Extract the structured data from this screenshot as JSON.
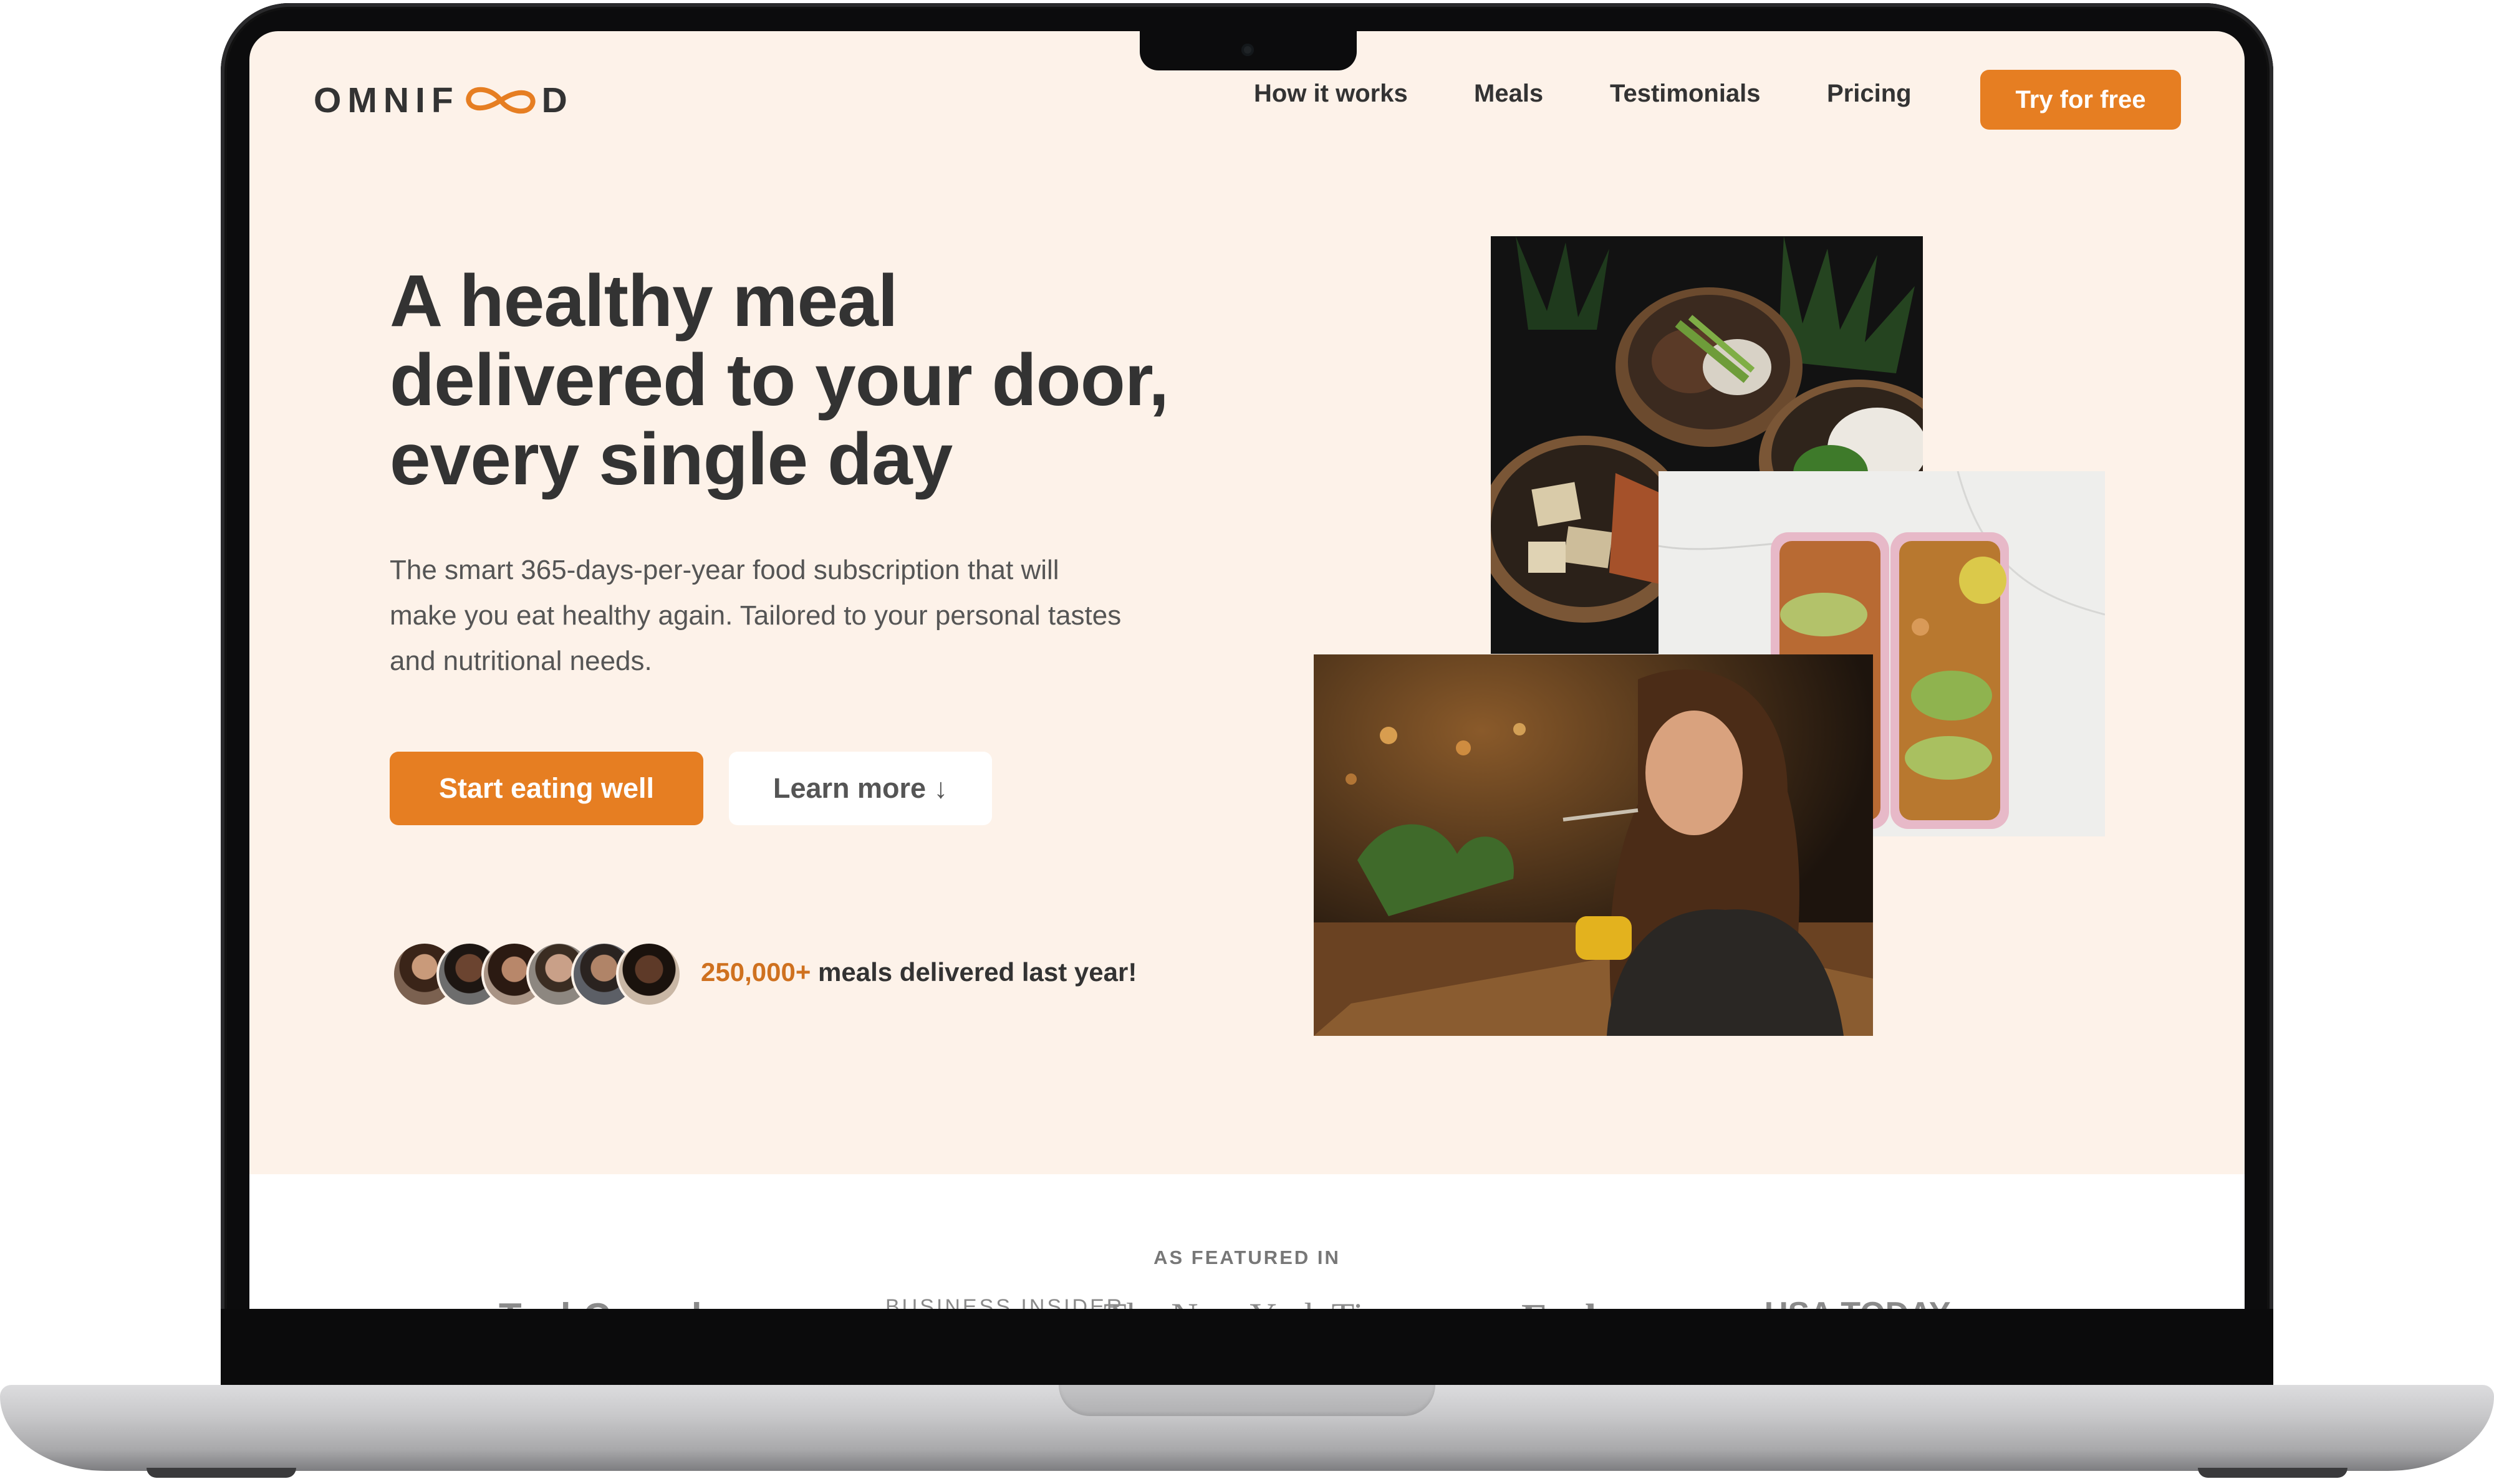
{
  "brand": {
    "logo_text_left": "OMNIF",
    "logo_text_right": "D",
    "accent": "#e67e22",
    "accent_dark": "#cf711f",
    "background": "#fdf2e9"
  },
  "nav": {
    "links": [
      "How it works",
      "Meals",
      "Testimonials",
      "Pricing"
    ],
    "cta": "Try for free"
  },
  "hero": {
    "title_line1": "A healthy meal",
    "title_line2": "delivered to your door,",
    "title_line3": "every single day",
    "description_line1": "The smart 365-days-per-year food subscription that will",
    "description_line2": "make you eat healthy again. Tailored to your personal tastes",
    "description_line3": "and nutritional needs.",
    "primary_button": "Start eating well",
    "secondary_button": "Learn more ↓",
    "delivered_count": "250,000+",
    "delivered_text": "meals delivered last year!"
  },
  "featured": {
    "label": "AS FEATURED IN",
    "logos": [
      "TechCrunch",
      "BUSINESS INSIDER",
      "The New York Times",
      "Forbes",
      "USA TODAY"
    ]
  }
}
